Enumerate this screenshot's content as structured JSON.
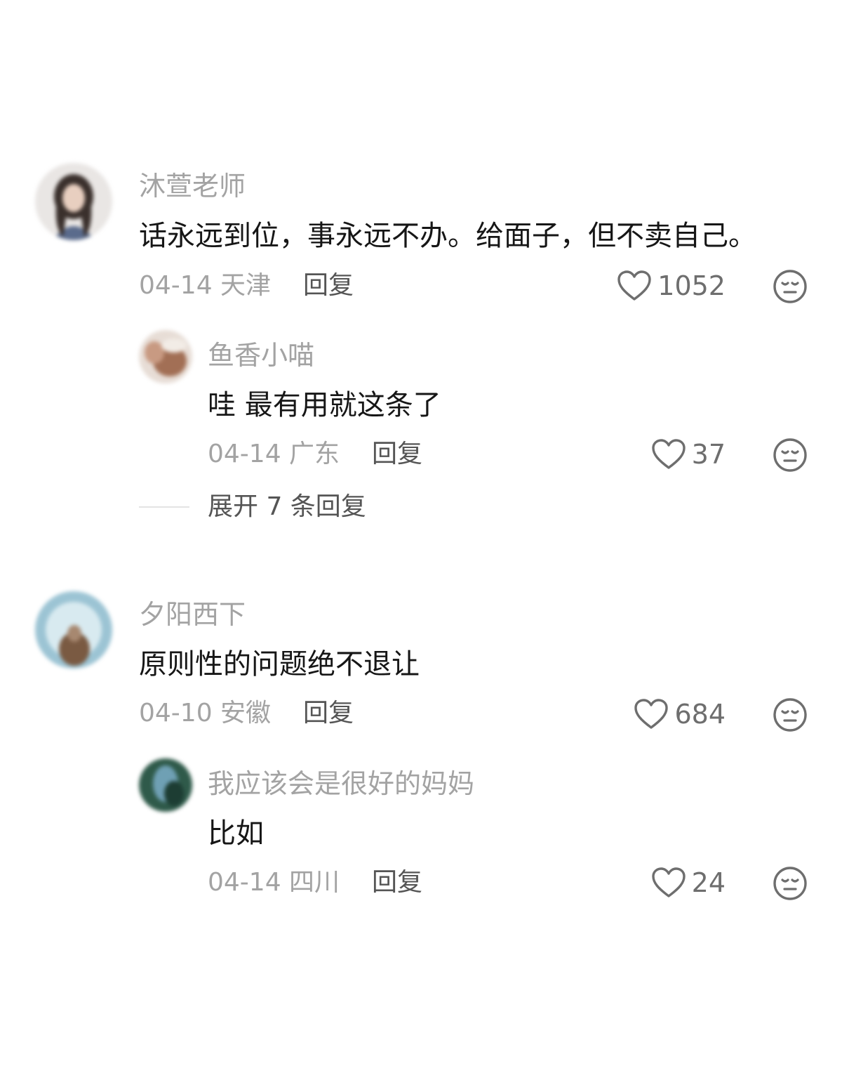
{
  "comments": [
    {
      "username": "沐萱老师",
      "text": "话永远到位，事永远不办。给面子，但不卖自己。",
      "date_location": "04-14 天津",
      "reply_label": "回复",
      "likes": "1052",
      "replies": [
        {
          "username": "鱼香小喵",
          "text": "哇 最有用就这条了",
          "date_location": "04-14 广东",
          "reply_label": "回复",
          "likes": "37"
        }
      ],
      "expand_label": "展开 7 条回复"
    },
    {
      "username": "夕阳西下",
      "text": "原则性的问题绝不退让",
      "date_location": "04-10 安徽",
      "reply_label": "回复",
      "likes": "684",
      "replies": [
        {
          "username": "我应该会是很好的妈妈",
          "text": "比如",
          "date_location": "04-14 四川",
          "reply_label": "回复",
          "likes": "24"
        }
      ]
    }
  ],
  "icons": {
    "like": "heart-outline-icon",
    "dislike": "neutral-face-icon"
  },
  "colors": {
    "background": "#ffffff",
    "username": "#a3a3a3",
    "text": "#161616",
    "meta": "#a3a3a3",
    "reply": "#555555",
    "icon": "#6e6e6e"
  }
}
